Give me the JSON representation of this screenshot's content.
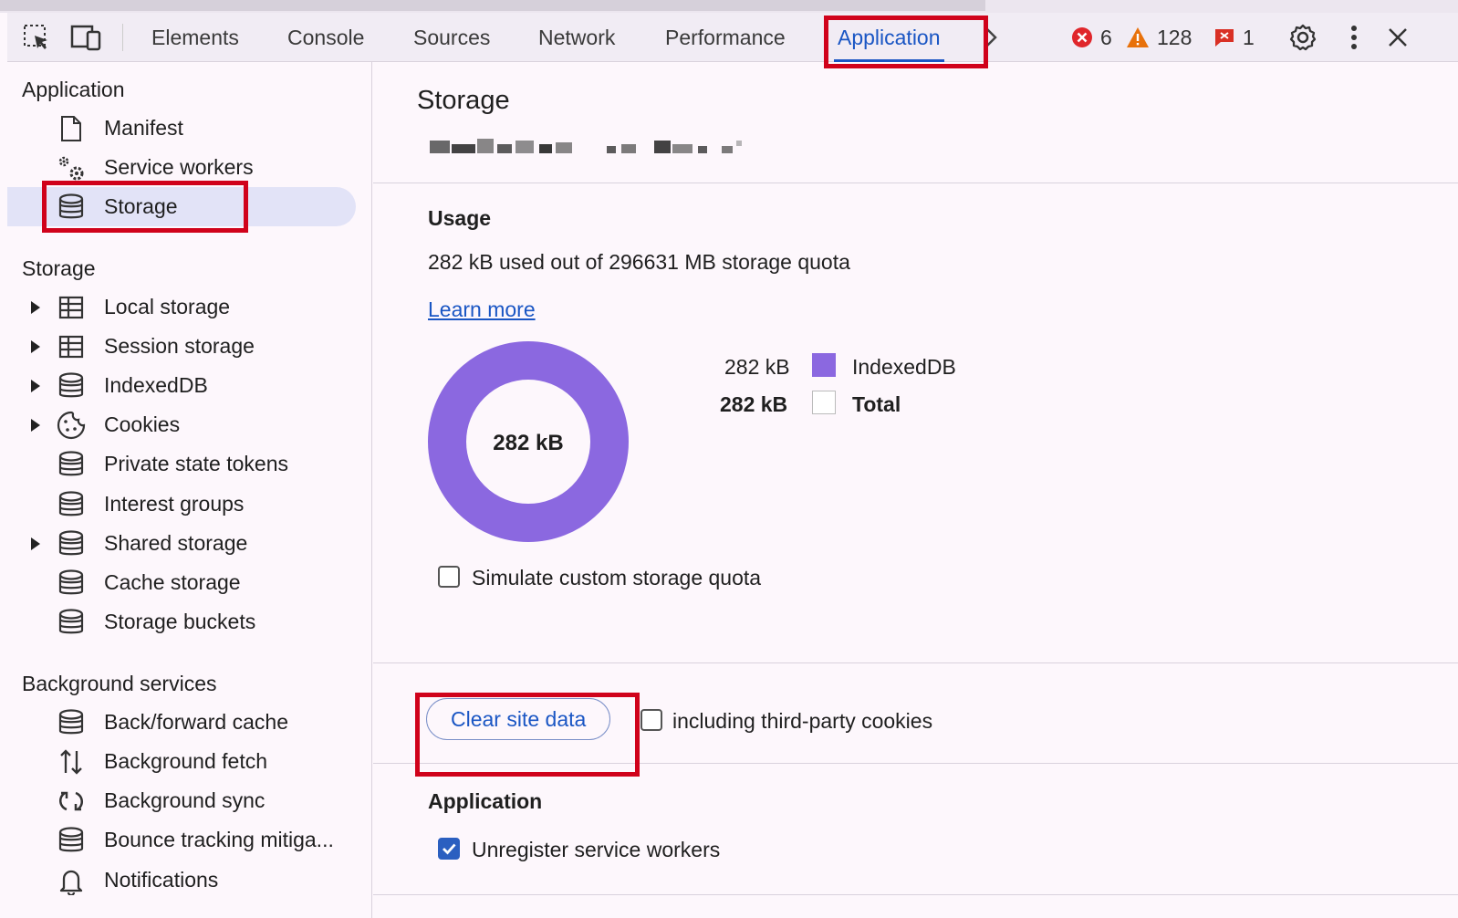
{
  "toolbar": {
    "tabs": [
      {
        "label": "Elements"
      },
      {
        "label": "Console"
      },
      {
        "label": "Sources"
      },
      {
        "label": "Network"
      },
      {
        "label": "Performance"
      },
      {
        "label": "Application"
      }
    ],
    "active_tab": "Application",
    "errors_count": "6",
    "warnings_count": "128",
    "issues_count": "1"
  },
  "sidebar": {
    "application_heading": "Application",
    "application_items": [
      {
        "label": "Manifest",
        "icon": "file-icon"
      },
      {
        "label": "Service workers",
        "icon": "gears-icon"
      },
      {
        "label": "Storage",
        "icon": "database-icon"
      }
    ],
    "storage_heading": "Storage",
    "storage_items": [
      {
        "label": "Local storage",
        "icon": "table-icon",
        "expandable": true
      },
      {
        "label": "Session storage",
        "icon": "table-icon",
        "expandable": true
      },
      {
        "label": "IndexedDB",
        "icon": "database-icon",
        "expandable": true
      },
      {
        "label": "Cookies",
        "icon": "cookie-icon",
        "expandable": true
      },
      {
        "label": "Private state tokens",
        "icon": "database-icon",
        "expandable": false
      },
      {
        "label": "Interest groups",
        "icon": "database-icon",
        "expandable": false
      },
      {
        "label": "Shared storage",
        "icon": "database-icon",
        "expandable": true
      },
      {
        "label": "Cache storage",
        "icon": "database-icon",
        "expandable": false
      },
      {
        "label": "Storage buckets",
        "icon": "database-icon",
        "expandable": false
      }
    ],
    "background_heading": "Background services",
    "background_items": [
      {
        "label": "Back/forward cache",
        "icon": "database-icon"
      },
      {
        "label": "Background fetch",
        "icon": "arrows-updown-icon"
      },
      {
        "label": "Background sync",
        "icon": "sync-icon"
      },
      {
        "label": "Bounce tracking mitiga...",
        "icon": "database-icon"
      },
      {
        "label": "Notifications",
        "icon": "bell-icon"
      }
    ]
  },
  "main": {
    "title": "Storage",
    "usage": {
      "heading": "Usage",
      "summary": "282 kB used out of 296631 MB storage quota",
      "learn_more": "Learn more",
      "donut_center": "282 kB",
      "legend": [
        {
          "value": "282 kB",
          "label": "IndexedDB",
          "color": "#8b68e0",
          "bold": false
        },
        {
          "value": "282 kB",
          "label": "Total",
          "color": "#ffffff",
          "bold": true
        }
      ],
      "simulate_label": "Simulate custom storage quota"
    },
    "clear": {
      "button_label": "Clear site data",
      "third_party_label": "including third-party cookies"
    },
    "application": {
      "heading": "Application",
      "unregister_label": "Unregister service workers"
    }
  },
  "colors": {
    "accent": "#1a56c4",
    "highlight": "#d0021b",
    "donut": "#8b68e0"
  }
}
